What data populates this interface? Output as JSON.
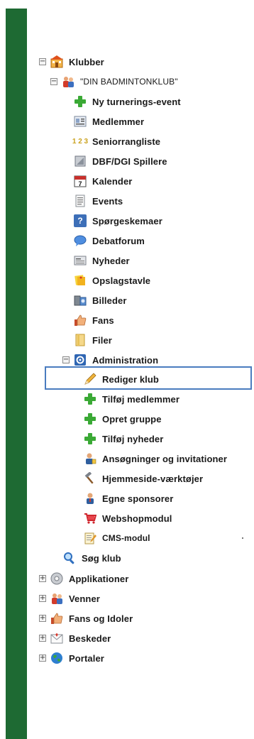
{
  "tree": {
    "klubber": "Klubber",
    "club": "\"DIN BADMINTONKLUB\"",
    "ny_turnering": "Ny turnerings-event",
    "medlemmer": "Medlemmer",
    "seniorrangliste": "Seniorrangliste",
    "dbf_dgi": "DBF/DGI Spillere",
    "kalender": "Kalender",
    "events": "Events",
    "sporgeskemaer": "Spørgeskemaer",
    "debatforum": "Debatforum",
    "nyheder": "Nyheder",
    "opslagstavle": "Opslagstavle",
    "billeder": "Billeder",
    "fans": "Fans",
    "filer": "Filer",
    "administration": "Administration",
    "rediger_klub": "Rediger klub",
    "tilfoj_medlemmer": "Tilføj medlemmer",
    "opret_gruppe": "Opret gruppe",
    "tilfoj_nyheder": "Tilføj nyheder",
    "ansogninger": "Ansøgninger og invitationer",
    "hjemmeside": "Hjemmeside-værktøjer",
    "egne_sponsorer": "Egne sponsorer",
    "webshopmodul": "Webshopmodul",
    "cms_modul": "CMS-modul",
    "sog_klub": "Søg klub",
    "applikationer": "Applikationer",
    "venner": "Venner",
    "fans_og_idoler": "Fans og Idoler",
    "beskeder": "Beskeder",
    "portaler": "Portaler"
  },
  "toggles": {
    "expanded": "−",
    "collapsed": "+"
  },
  "seniorrangliste_icon_text": "1 2 3",
  "kalender_icon_text": "7",
  "sporgeskemaer_icon_text": "?",
  "colors": {
    "sidebar": "#1e6a33",
    "highlight_border": "#4a7cbf",
    "plus_green": "#3aa935"
  },
  "selected_item": "Rediger klub"
}
